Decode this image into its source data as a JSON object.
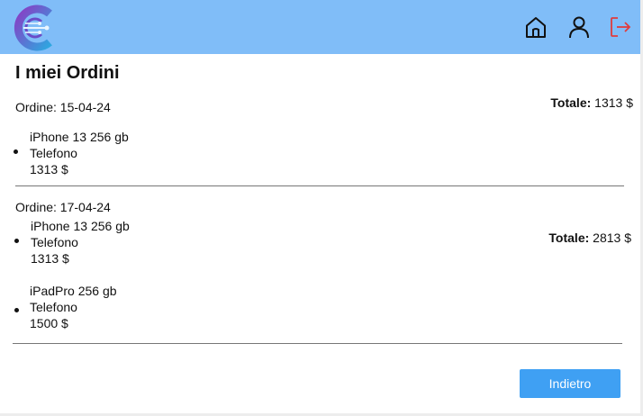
{
  "header": {
    "icons": [
      "home-icon",
      "user-icon",
      "logout-icon"
    ],
    "colors": {
      "bar": "#80bdf8",
      "logout": "#e03c3c"
    }
  },
  "page": {
    "title": "I miei Ordini"
  },
  "orders": [
    {
      "date_label": "Ordine: 15-04-24",
      "total_label": "Totale:",
      "total_value": "1313 $",
      "items": [
        {
          "name": "iPhone 13 256 gb",
          "category": "Telefono",
          "price": "1313 $"
        }
      ]
    },
    {
      "date_label": "Ordine: 17-04-24",
      "total_label": "Totale:",
      "total_value": "2813 $",
      "items": [
        {
          "name": "iPhone 13 256 gb",
          "category": "Telefono",
          "price": "1313 $"
        },
        {
          "name": "iPadPro 256 gb",
          "category": "Telefono",
          "price": "1500 $"
        }
      ]
    }
  ],
  "actions": {
    "back_label": "Indietro",
    "button_color": "#3fa0f3"
  }
}
